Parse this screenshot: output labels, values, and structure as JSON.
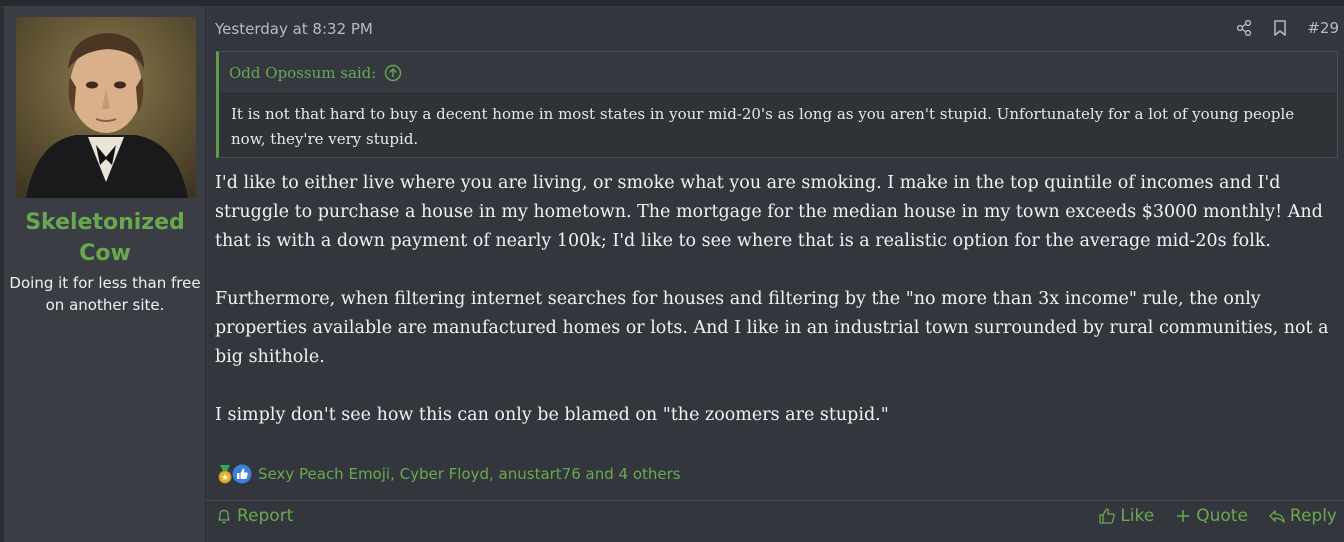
{
  "post": {
    "date": "Yesterday at 8:32 PM",
    "number": "#29",
    "author": {
      "name": "Skeletonized Cow",
      "title": "Doing it for less than free on another site."
    },
    "quote": {
      "author_said": "Odd Opossum said:",
      "text": "It is not that hard to buy a decent home in most states in your mid-20's as long as you aren't stupid. Unfortunately for a lot of young people now, they're very stupid."
    },
    "paragraphs": [
      "I'd like to either live where you are living, or smoke what you are smoking. I make in the top quintile of incomes and I'd struggle to purchase a house in my hometown. The mortgage for the median house in my town exceeds $3000 monthly! And that is with a down payment of nearly 100k; I'd like to see where that is a realistic option for the average mid-20s folk.",
      "Furthermore, when filtering internet searches for houses and filtering by the \"no more than 3x income\" rule, the only properties available are manufactured homes or lots. And I like in an industrial town surrounded by rural communities, not a big shithole.",
      "I simply don't see how this can only be blamed on \"the zoomers are stupid.\""
    ],
    "reactions": {
      "icons": [
        "medal-icon",
        "thumbs-up-icon"
      ],
      "text": "Sexy Peach Emoji, Cyber Floyd, anustart76 and 4 others"
    },
    "footer": {
      "report_label": "Report",
      "like_label": "Like",
      "quote_label": "Quote",
      "reply_label": "Reply"
    }
  },
  "colors": {
    "accent_green": "#6aa84f",
    "background": "#2b2e33",
    "post_bg": "#33363c",
    "user_col_bg": "#3a3e44"
  }
}
